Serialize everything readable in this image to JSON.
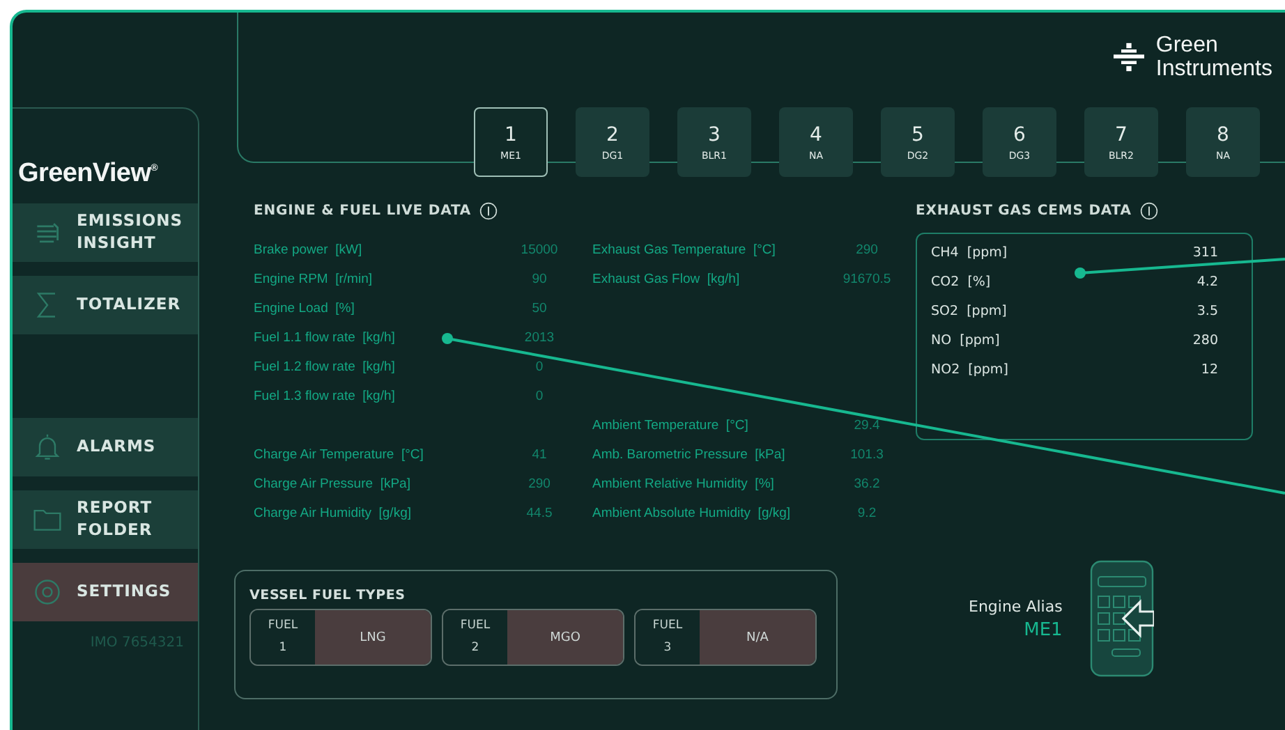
{
  "brand": {
    "line1": "Green",
    "line2": "Instruments"
  },
  "sidebar": {
    "logo": "GreenView$^{®}$",
    "groups": [
      [
        {
          "kind": "emissions",
          "label": "EMISSIONS INSIGHT",
          "selected": false
        },
        {
          "kind": "totalizer",
          "label": "TOTALIZER",
          "selected": false
        }
      ],
      [
        {
          "kind": "alarms",
          "label": "ALARMS",
          "selected": false
        },
        {
          "kind": "folder",
          "label": "REPORT FOLDER",
          "selected": false
        },
        {
          "kind": "settings",
          "label": "SETTINGS",
          "selected": true
        }
      ]
    ],
    "imo": "IMO 7654321"
  },
  "tabs": [
    {
      "number": "1",
      "alias": "ME1",
      "selected": true
    },
    {
      "number": "2",
      "alias": "DG1",
      "selected": false
    },
    {
      "number": "3",
      "alias": "BLR1",
      "selected": false
    },
    {
      "number": "4",
      "alias": "NA",
      "selected": false
    },
    {
      "number": "5",
      "alias": "DG2",
      "selected": false
    },
    {
      "number": "6",
      "alias": "DG3",
      "selected": false
    },
    {
      "number": "7",
      "alias": "BLR2",
      "selected": false
    },
    {
      "number": "8",
      "alias": "NA",
      "selected": false
    }
  ],
  "engine_data": {
    "title": "ENGINE & FUEL LIVE DATA",
    "rows": [
      {
        "left": {
          "label": "Brake power  [kW]",
          "value": "15000"
        },
        "right": {
          "label": "Exhaust Gas Temperature  [°C]",
          "value": "290"
        }
      },
      {
        "left": {
          "label": "Engine RPM  [r/min]",
          "value": "90"
        },
        "right": {
          "label": "Exhaust Gas Flow  [kg/h]",
          "value": "91670.5"
        }
      },
      {
        "left": {
          "label": "Engine Load  [%]",
          "value": "50"
        },
        "right": null
      },
      {
        "left": {
          "label": "Fuel 1.1 flow rate  [kg/h]",
          "value": "2013"
        },
        "right": null
      },
      {
        "left": {
          "label": "Fuel 1.2 flow rate  [kg/h]",
          "value": "0"
        },
        "right": null
      },
      {
        "left": {
          "label": "Fuel 1.3 flow rate  [kg/h]",
          "value": "0"
        },
        "right": null
      },
      {
        "left": null,
        "right": {
          "label": "Ambient Temperature  [°C]",
          "value": "29.4"
        }
      },
      {
        "left": {
          "label": "Charge Air Temperature  [°C]",
          "value": "41"
        },
        "right": {
          "label": "Amb. Barometric Pressure  [kPa]",
          "value": "101.3"
        }
      },
      {
        "left": {
          "label": "Charge Air Pressure  [kPa]",
          "value": "290"
        },
        "right": {
          "label": "Ambient Relative Humidity  [%]",
          "value": "36.2"
        }
      },
      {
        "left": {
          "label": "Charge Air Humidity  [g/kg]",
          "value": "44.5"
        },
        "right": {
          "label": "Ambient Absolute Humidity  [g/kg]",
          "value": "9.2"
        }
      }
    ]
  },
  "cems": {
    "title": "EXHAUST GAS CEMS DATA",
    "rows": [
      {
        "label": "CH4  [ppm]",
        "value": "311"
      },
      {
        "label": "CO2  [%]",
        "value": "4.2"
      },
      {
        "label": "SO2  [ppm]",
        "value": "3.5"
      },
      {
        "label": "NO  [ppm]",
        "value": "280"
      },
      {
        "label": "NO2  [ppm]",
        "value": "12"
      }
    ]
  },
  "fuel_types": {
    "title": "VESSEL FUEL TYPES",
    "fuels": [
      {
        "label": "FUEL",
        "number": "1",
        "value": "LNG"
      },
      {
        "label": "FUEL",
        "number": "2",
        "value": "MGO"
      },
      {
        "label": "FUEL",
        "number": "3",
        "value": "N/A"
      }
    ]
  },
  "engine_alias": {
    "label": "Engine Alias",
    "value": "ME1"
  }
}
